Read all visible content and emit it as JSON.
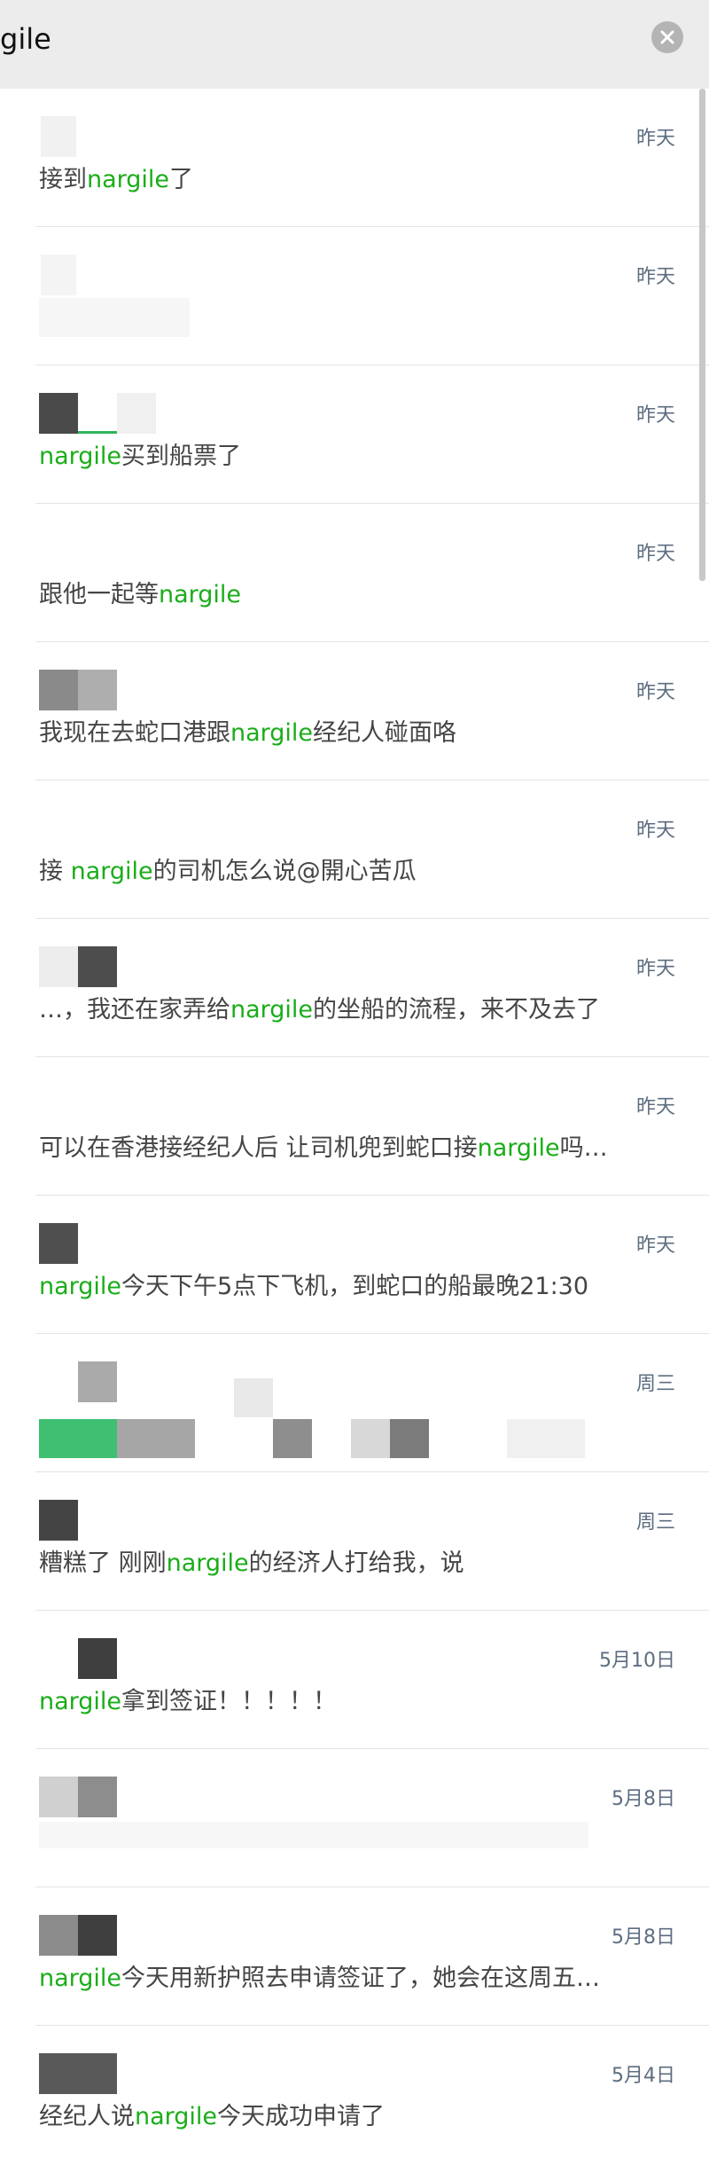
{
  "search": {
    "query": "gile"
  },
  "keyword": "nargile",
  "results": [
    {
      "time": "昨天",
      "pre": "接到",
      "kw": "nargile",
      "post": "了"
    },
    {
      "time": "昨天",
      "pre": "",
      "kw": "",
      "post": ""
    },
    {
      "time": "昨天",
      "pre": "",
      "kw": "nargile",
      "post": "买到船票了"
    },
    {
      "time": "昨天",
      "pre": "跟他一起等",
      "kw": "nargile",
      "post": ""
    },
    {
      "time": "昨天",
      "pre": "我现在去蛇口港跟",
      "kw": "nargile",
      "post": "经纪人碰面咯"
    },
    {
      "time": "昨天",
      "pre": "接 ",
      "kw": "nargile",
      "post": "的司机怎么说@開心苦瓜"
    },
    {
      "time": "昨天",
      "pre": "…，我还在家弄给",
      "kw": "nargile",
      "post": "的坐船的流程，来不及去了"
    },
    {
      "time": "昨天",
      "pre": "可以在香港接经纪人后 让司机兜到蛇口接",
      "kw": "nargile",
      "post": "吗…"
    },
    {
      "time": "昨天",
      "pre": "",
      "kw": "nargile",
      "post": "今天下午5点下飞机，到蛇口的船最晚21:30"
    },
    {
      "time": "周三",
      "pre": "",
      "kw": "",
      "post": ""
    },
    {
      "time": "周三",
      "pre": "糟糕了 刚刚",
      "kw": "nargile",
      "post": "的经济人打给我，说"
    },
    {
      "time": "5月10日",
      "pre": "",
      "kw": "nargile",
      "post": "拿到签证！！！！！"
    },
    {
      "time": "5月8日",
      "pre": "",
      "kw": "",
      "post": ""
    },
    {
      "time": "5月8日",
      "pre": "",
      "kw": "nargile",
      "post": "今天用新护照去申请签证了，她会在这周五…"
    },
    {
      "time": "5月4日",
      "pre": "经纪人说",
      "kw": "nargile",
      "post": "今天成功申请了"
    }
  ],
  "colors": {
    "keyword": "#1aad19",
    "timestamp": "#5d6d80",
    "text": "#454545"
  }
}
